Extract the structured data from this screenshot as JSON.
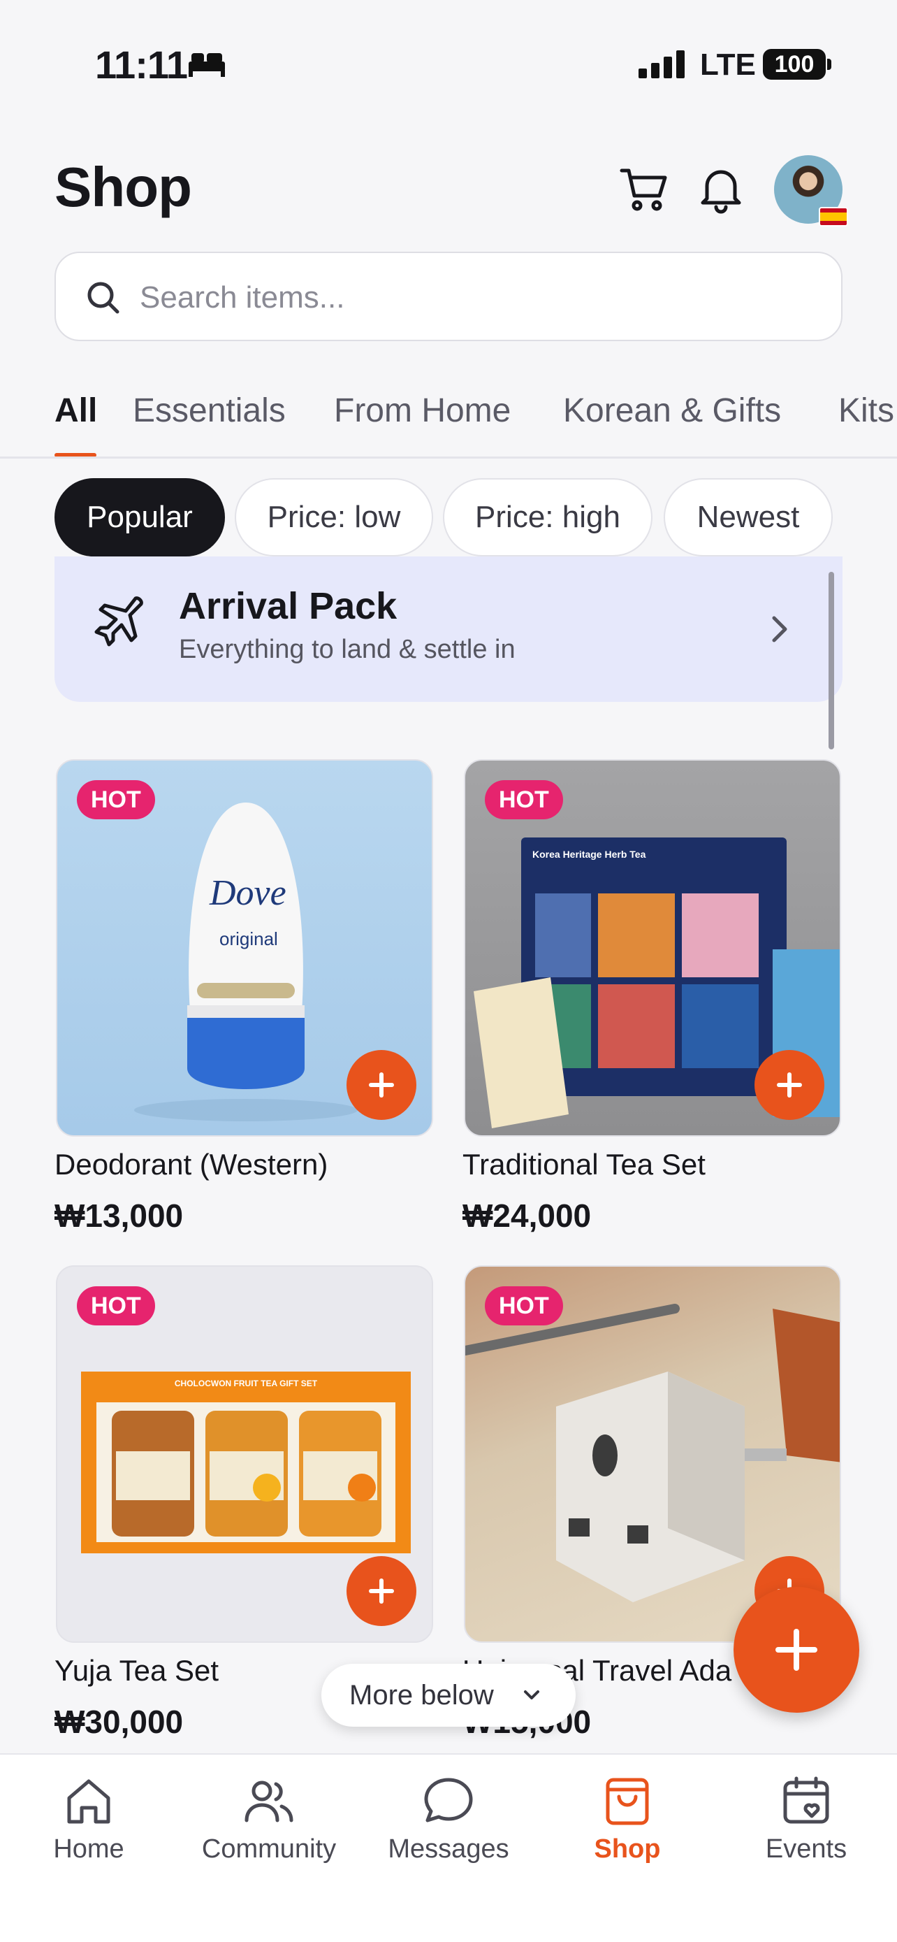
{
  "status_bar": {
    "time": "11:11",
    "network": "LTE",
    "battery": "100"
  },
  "header": {
    "title": "Shop"
  },
  "search": {
    "placeholder": "Search items..."
  },
  "tabs": [
    {
      "label": "All",
      "active": true
    },
    {
      "label": "Essentials"
    },
    {
      "label": "From Home"
    },
    {
      "label": "Korean & Gifts"
    },
    {
      "label": "Kits"
    }
  ],
  "sort_chips": [
    {
      "label": "Popular",
      "active": true
    },
    {
      "label": "Price: low"
    },
    {
      "label": "Price: high"
    },
    {
      "label": "Newest"
    }
  ],
  "banner": {
    "title": "Arrival Pack",
    "subtitle": "Everything to land & settle in"
  },
  "products": [
    {
      "badge": "HOT",
      "name": "Deodorant (Western)",
      "price": "₩13,000",
      "image_label": "Dove",
      "image_sublabel": "original"
    },
    {
      "badge": "HOT",
      "name": "Traditional Tea Set",
      "price": "₩24,000",
      "image_label": "Korea Heritage Herb Tea"
    },
    {
      "badge": "HOT",
      "name": "Yuja Tea Set",
      "price": "₩30,000",
      "image_label": "CHOLOCWON FRUIT TEA GIFT SET"
    },
    {
      "badge": "HOT",
      "name": "Universal Travel Ada",
      "price": "₩15,000"
    }
  ],
  "more_below": "More below",
  "nav": [
    {
      "label": "Home",
      "icon": "home-icon"
    },
    {
      "label": "Community",
      "icon": "users-icon"
    },
    {
      "label": "Messages",
      "icon": "chat-bubble-icon"
    },
    {
      "label": "Shop",
      "icon": "shopping-bag-icon",
      "active": true
    },
    {
      "label": "Events",
      "icon": "calendar-heart-icon"
    }
  ],
  "colors": {
    "accent": "#e8531c",
    "hot_badge": "#e6246e",
    "banner_bg": "#e6e8fb"
  }
}
